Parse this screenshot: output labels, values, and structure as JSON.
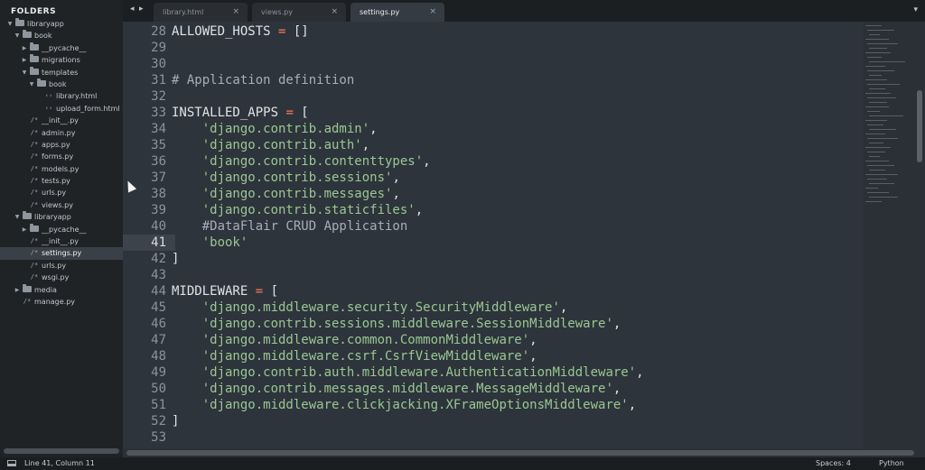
{
  "sidebar": {
    "title": "FOLDERS",
    "tree": [
      {
        "label": "libraryapp",
        "kind": "folder",
        "open": true,
        "depth": 0
      },
      {
        "label": "book",
        "kind": "folder",
        "open": true,
        "depth": 1
      },
      {
        "label": "__pycache__",
        "kind": "folder",
        "open": false,
        "depth": 2
      },
      {
        "label": "migrations",
        "kind": "folder",
        "open": false,
        "depth": 2
      },
      {
        "label": "templates",
        "kind": "folder",
        "open": true,
        "depth": 2
      },
      {
        "label": "book",
        "kind": "folder",
        "open": true,
        "depth": 3
      },
      {
        "label": "library.html",
        "kind": "html",
        "depth": 4
      },
      {
        "label": "upload_form.html",
        "kind": "html",
        "depth": 4
      },
      {
        "label": "__init__.py",
        "kind": "py",
        "depth": 2
      },
      {
        "label": "admin.py",
        "kind": "py",
        "depth": 2
      },
      {
        "label": "apps.py",
        "kind": "py",
        "depth": 2
      },
      {
        "label": "forms.py",
        "kind": "py",
        "depth": 2
      },
      {
        "label": "models.py",
        "kind": "py",
        "depth": 2
      },
      {
        "label": "tests.py",
        "kind": "py",
        "depth": 2
      },
      {
        "label": "urls.py",
        "kind": "py",
        "depth": 2
      },
      {
        "label": "views.py",
        "kind": "py",
        "depth": 2
      },
      {
        "label": "libraryapp",
        "kind": "folder",
        "open": true,
        "depth": 1
      },
      {
        "label": "__pycache__",
        "kind": "folder",
        "open": false,
        "depth": 2
      },
      {
        "label": "__init__.py",
        "kind": "py",
        "depth": 2
      },
      {
        "label": "settings.py",
        "kind": "py",
        "depth": 2,
        "selected": true
      },
      {
        "label": "urls.py",
        "kind": "py",
        "depth": 2
      },
      {
        "label": "wsgi.py",
        "kind": "py",
        "depth": 2
      },
      {
        "label": "media",
        "kind": "folder",
        "open": false,
        "depth": 1
      },
      {
        "label": "manage.py",
        "kind": "py",
        "depth": 1
      }
    ]
  },
  "tabs": {
    "nav_left": "◂",
    "nav_right": "▸",
    "overflow": "▾",
    "items": [
      {
        "label": "library.html",
        "active": false
      },
      {
        "label": "views.py",
        "active": false
      },
      {
        "label": "settings.py",
        "active": true
      }
    ],
    "close_glyph": "×"
  },
  "editor": {
    "current_line": 41,
    "lines": [
      {
        "n": "28",
        "tokens": [
          {
            "t": "ALLOWED_HOSTS ",
            "c": ""
          },
          {
            "t": "=",
            "c": "op"
          },
          {
            "t": " []",
            "c": ""
          }
        ]
      },
      {
        "n": "29",
        "tokens": []
      },
      {
        "n": "30",
        "tokens": []
      },
      {
        "n": "31",
        "tokens": [
          {
            "t": "# Application definition",
            "c": "com"
          }
        ]
      },
      {
        "n": "32",
        "tokens": []
      },
      {
        "n": "33",
        "tokens": [
          {
            "t": "INSTALLED_APPS ",
            "c": ""
          },
          {
            "t": "=",
            "c": "op"
          },
          {
            "t": " [",
            "c": ""
          }
        ]
      },
      {
        "n": "34",
        "tokens": [
          {
            "t": "    ",
            "c": ""
          },
          {
            "t": "'django.contrib.admin'",
            "c": "str"
          },
          {
            "t": ",",
            "c": ""
          }
        ]
      },
      {
        "n": "35",
        "tokens": [
          {
            "t": "    ",
            "c": ""
          },
          {
            "t": "'django.contrib.auth'",
            "c": "str"
          },
          {
            "t": ",",
            "c": ""
          }
        ]
      },
      {
        "n": "36",
        "tokens": [
          {
            "t": "    ",
            "c": ""
          },
          {
            "t": "'django.contrib.contenttypes'",
            "c": "str"
          },
          {
            "t": ",",
            "c": ""
          }
        ]
      },
      {
        "n": "37",
        "tokens": [
          {
            "t": "    ",
            "c": ""
          },
          {
            "t": "'django.contrib.sessions'",
            "c": "str"
          },
          {
            "t": ",",
            "c": ""
          }
        ]
      },
      {
        "n": "38",
        "tokens": [
          {
            "t": "    ",
            "c": ""
          },
          {
            "t": "'django.contrib.messages'",
            "c": "str"
          },
          {
            "t": ",",
            "c": ""
          }
        ]
      },
      {
        "n": "39",
        "tokens": [
          {
            "t": "    ",
            "c": ""
          },
          {
            "t": "'django.contrib.staticfiles'",
            "c": "str"
          },
          {
            "t": ",",
            "c": ""
          }
        ]
      },
      {
        "n": "40",
        "tokens": [
          {
            "t": "    ",
            "c": ""
          },
          {
            "t": "#DataFlair CRUD Application",
            "c": "com"
          }
        ]
      },
      {
        "n": "41",
        "tokens": [
          {
            "t": "    ",
            "c": ""
          },
          {
            "t": "'book'",
            "c": "str"
          }
        ]
      },
      {
        "n": "42",
        "tokens": [
          {
            "t": "]",
            "c": ""
          }
        ]
      },
      {
        "n": "43",
        "tokens": []
      },
      {
        "n": "44",
        "tokens": [
          {
            "t": "MIDDLEWARE ",
            "c": ""
          },
          {
            "t": "=",
            "c": "op"
          },
          {
            "t": " [",
            "c": ""
          }
        ]
      },
      {
        "n": "45",
        "tokens": [
          {
            "t": "    ",
            "c": ""
          },
          {
            "t": "'django.middleware.security.SecurityMiddleware'",
            "c": "str"
          },
          {
            "t": ",",
            "c": ""
          }
        ]
      },
      {
        "n": "46",
        "tokens": [
          {
            "t": "    ",
            "c": ""
          },
          {
            "t": "'django.contrib.sessions.middleware.SessionMiddleware'",
            "c": "str"
          },
          {
            "t": ",",
            "c": ""
          }
        ]
      },
      {
        "n": "47",
        "tokens": [
          {
            "t": "    ",
            "c": ""
          },
          {
            "t": "'django.middleware.common.CommonMiddleware'",
            "c": "str"
          },
          {
            "t": ",",
            "c": ""
          }
        ]
      },
      {
        "n": "48",
        "tokens": [
          {
            "t": "    ",
            "c": ""
          },
          {
            "t": "'django.middleware.csrf.CsrfViewMiddleware'",
            "c": "str"
          },
          {
            "t": ",",
            "c": ""
          }
        ]
      },
      {
        "n": "49",
        "tokens": [
          {
            "t": "    ",
            "c": ""
          },
          {
            "t": "'django.contrib.auth.middleware.AuthenticationMiddleware'",
            "c": "str"
          },
          {
            "t": ",",
            "c": ""
          }
        ]
      },
      {
        "n": "50",
        "tokens": [
          {
            "t": "    ",
            "c": ""
          },
          {
            "t": "'django.contrib.messages.middleware.MessageMiddleware'",
            "c": "str"
          },
          {
            "t": ",",
            "c": ""
          }
        ]
      },
      {
        "n": "51",
        "tokens": [
          {
            "t": "    ",
            "c": ""
          },
          {
            "t": "'django.middleware.clickjacking.XFrameOptionsMiddleware'",
            "c": "str"
          },
          {
            "t": ",",
            "c": ""
          }
        ]
      },
      {
        "n": "52",
        "tokens": [
          {
            "t": "]",
            "c": ""
          }
        ]
      },
      {
        "n": "53",
        "tokens": []
      }
    ]
  },
  "status": {
    "position": "Line 41, Column 11",
    "spaces": "Spaces: 4",
    "syntax": "Python"
  },
  "colors": {
    "string": "#99c794",
    "operator": "#f97b58",
    "comment": "#a7adba",
    "background": "#2e343b"
  }
}
